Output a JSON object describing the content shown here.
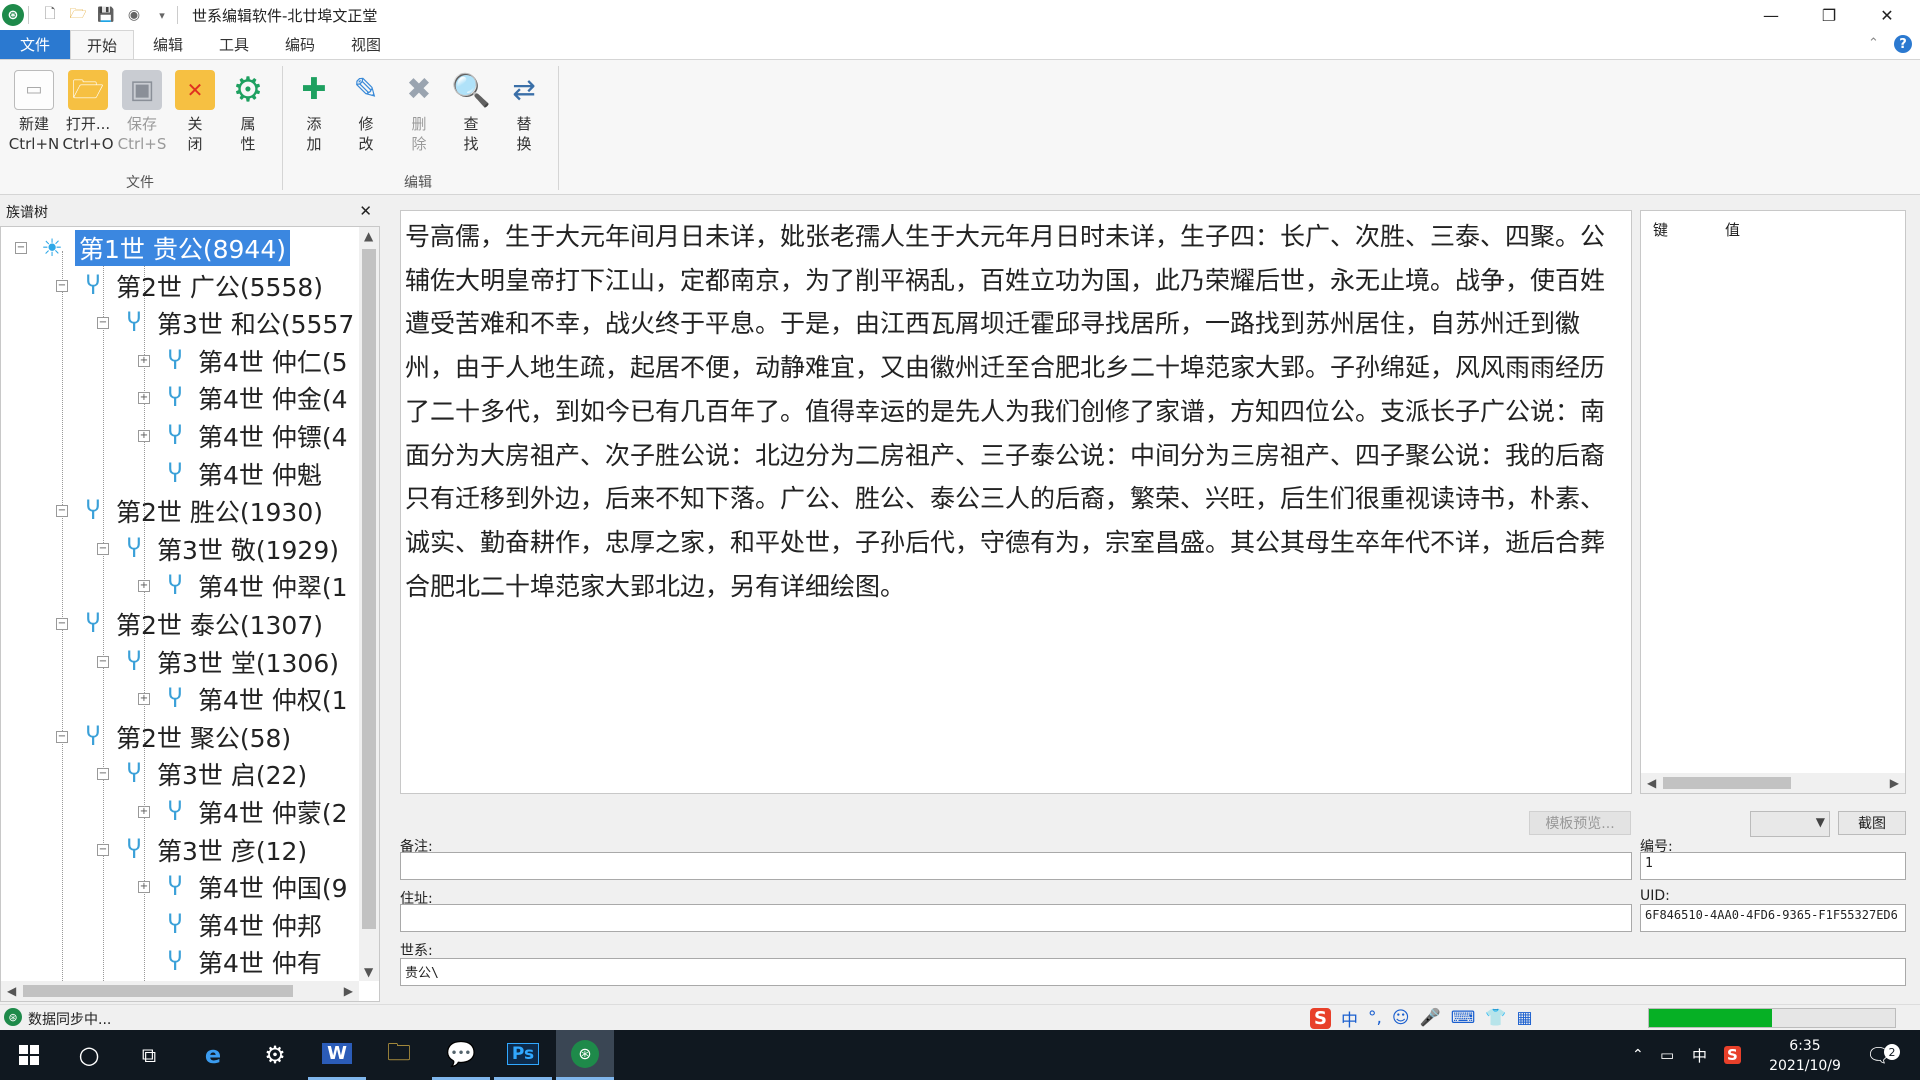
{
  "window": {
    "title": "世系编辑软件-北廿埠文正堂",
    "controls": {
      "minimize": "—",
      "restore": "❐",
      "close": "✕"
    }
  },
  "menu": {
    "tabs": [
      {
        "label": "文件"
      },
      {
        "label": "开始"
      },
      {
        "label": "编辑"
      },
      {
        "label": "工具"
      },
      {
        "label": "编码"
      },
      {
        "label": "视图"
      }
    ]
  },
  "ribbon": {
    "file_group": {
      "label": "文件",
      "buttons": [
        {
          "line1": "新建",
          "line2": "Ctrl+N",
          "icon": "new-file-icon",
          "enabled": true
        },
        {
          "line1": "打开...",
          "line2": "Ctrl+O",
          "icon": "open-folder-icon",
          "enabled": true
        },
        {
          "line1": "保存",
          "line2": "Ctrl+S",
          "icon": "save-icon",
          "enabled": false
        },
        {
          "line1": "关",
          "line2": "闭",
          "icon": "close-folder-icon",
          "enabled": true
        },
        {
          "line1": "属",
          "line2": "性",
          "icon": "properties-gear-icon",
          "enabled": true
        }
      ]
    },
    "edit_group": {
      "label": "编辑",
      "buttons": [
        {
          "line1": "添",
          "line2": "加",
          "icon": "add-person-icon",
          "enabled": true
        },
        {
          "line1": "修",
          "line2": "改",
          "icon": "edit-person-icon",
          "enabled": true
        },
        {
          "line1": "删",
          "line2": "除",
          "icon": "delete-person-icon",
          "enabled": false
        },
        {
          "line1": "查",
          "line2": "找",
          "icon": "search-icon",
          "enabled": true
        },
        {
          "line1": "替",
          "line2": "换",
          "icon": "replace-icon",
          "enabled": true
        }
      ]
    }
  },
  "tree": {
    "title": "族谱树",
    "close": "✕",
    "nodes": [
      {
        "label": "第1世 贵公(8944)",
        "depth": 0,
        "expander": "⊟",
        "selected": true
      },
      {
        "label": "第2世 广公(5558)",
        "depth": 1,
        "expander": "⊟"
      },
      {
        "label": "第3世 和公(5557",
        "depth": 2,
        "expander": "⊟"
      },
      {
        "label": "第4世 仲仁(5",
        "depth": 3,
        "expander": "⊞"
      },
      {
        "label": "第4世 仲金(4",
        "depth": 3,
        "expander": "⊞"
      },
      {
        "label": "第4世 仲镖(4",
        "depth": 3,
        "expander": "⊞"
      },
      {
        "label": "第4世 仲魁",
        "depth": 3,
        "expander": ""
      },
      {
        "label": "第2世 胜公(1930)",
        "depth": 1,
        "expander": "⊟"
      },
      {
        "label": "第3世 敬(1929)",
        "depth": 2,
        "expander": "⊟"
      },
      {
        "label": "第4世 仲翠(1",
        "depth": 3,
        "expander": "⊞"
      },
      {
        "label": "第2世 泰公(1307)",
        "depth": 1,
        "expander": "⊟"
      },
      {
        "label": "第3世 堂(1306)",
        "depth": 2,
        "expander": "⊟"
      },
      {
        "label": "第4世 仲权(1",
        "depth": 3,
        "expander": "⊞"
      },
      {
        "label": "第2世 聚公(58)",
        "depth": 1,
        "expander": "⊟"
      },
      {
        "label": "第3世 启(22)",
        "depth": 2,
        "expander": "⊟"
      },
      {
        "label": "第4世 仲蒙(2",
        "depth": 3,
        "expander": "⊞"
      },
      {
        "label": "第3世 彦(12)",
        "depth": 2,
        "expander": "⊟"
      },
      {
        "label": "第4世 仲国(9",
        "depth": 3,
        "expander": "⊞"
      },
      {
        "label": "第4世 仲邦",
        "depth": 3,
        "expander": ""
      },
      {
        "label": "第4世 仲有",
        "depth": 3,
        "expander": ""
      }
    ]
  },
  "main_text": {
    "lines": [
      "号高儒，生于大元年间月日未详，妣张老孺人生于大元年月日时未详，生子四：长广、次胜、三泰、四聚。公",
      "辅佐大明皇帝打下江山，定都南京，为了削平祸乱，百姓立功为国，此乃荣耀后世，永无止境。战争，使百姓",
      "遭受苦难和不幸，战火终于平息。于是，由江西瓦屑坝迁霍邱寻找居所，一路找到苏州居住，自苏州迁到徽",
      "州，由于人地生疏，起居不便，动静难宜，又由徽州迁至合肥北乡二十埠范家大郢。子孙绵延，风风雨雨经历",
      "了二十多代，到如今已有几百年了。值得幸运的是先人为我们创修了家谱，方知四位公。支派长子广公说：南",
      "面分为大房祖产、次子胜公说：北边分为二房祖产、三子泰公说：中间分为三房祖产、四子聚公说：我的后裔",
      "只有迁移到外边，后来不知下落。广公、胜公、泰公三人的后裔，繁荣、兴旺，后生们很重视读诗书，朴素、",
      "诚实、勤奋耕作，忠厚之家，和平处世，子孙后代，守德有为，宗室昌盛。其公其母生卒年代不详，逝后合葬",
      "合肥北二十埠范家大郢北边，另有详细绘图。"
    ]
  },
  "kv_grid": {
    "col_key": "键",
    "col_value": "值"
  },
  "form": {
    "template_preview_button": "模板预览...",
    "screenshot_button": "截图",
    "remark_label": "备注:",
    "remark_value": "",
    "address_label": "住址:",
    "address_value": "",
    "lineage_label": "世系:",
    "lineage_value": "贵公\\",
    "number_label": "编号:",
    "number_value": "1",
    "uid_label": "UID:",
    "uid_value": "6F846510-4AA0-4FD6-9365-F1F55327ED6"
  },
  "status": {
    "text": "数据同步中...",
    "progress": 0.5
  },
  "ime": {
    "logo": "S",
    "mode": "中",
    "items": [
      "°,",
      "☺",
      "🎤",
      "⌨",
      "👕",
      "▦"
    ]
  },
  "taskbar": {
    "clock_time": "6:35",
    "clock_date": "2021/10/9",
    "ime_lang": "中",
    "notifications": "2"
  }
}
